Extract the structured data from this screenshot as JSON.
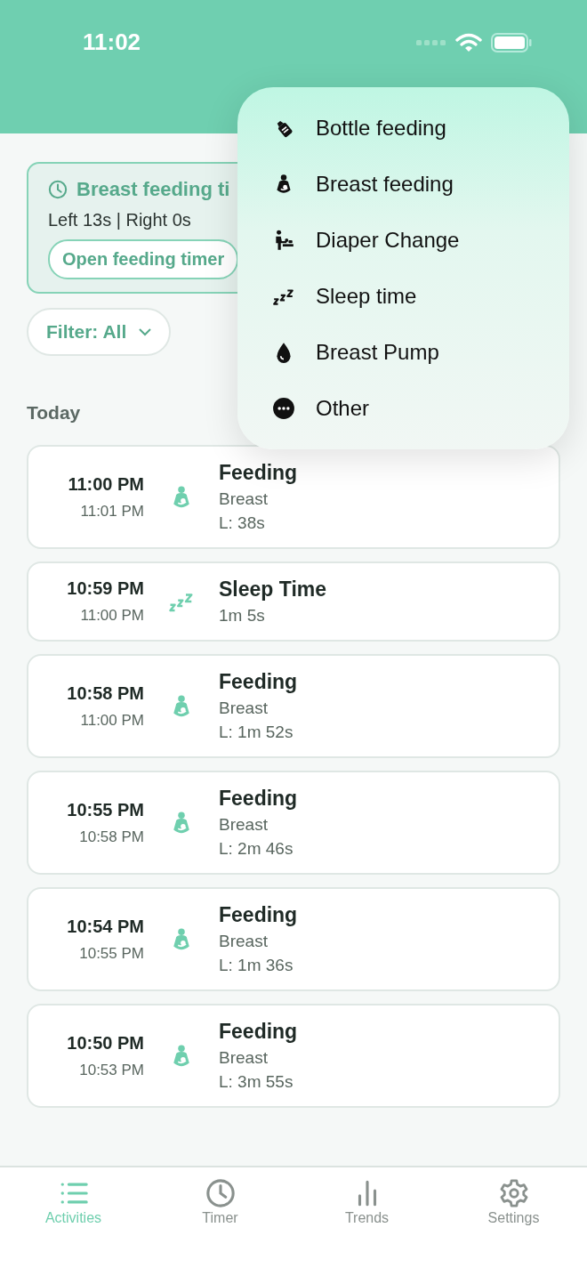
{
  "status_bar": {
    "time": "11:02"
  },
  "timer_card": {
    "title": "Breast feeding ti",
    "detail": "Left 13s | Right 0s",
    "button": "Open feeding timer"
  },
  "filter": {
    "label": "Filter: All"
  },
  "section": "Today",
  "entries": [
    {
      "kind": "feeding",
      "start": "11:00 PM",
      "end": "11:01 PM",
      "title": "Feeding",
      "lines": [
        "Breast",
        "L: 38s"
      ]
    },
    {
      "kind": "sleep",
      "start": "10:59 PM",
      "end": "11:00 PM",
      "title": "Sleep Time",
      "lines": [
        "1m 5s"
      ]
    },
    {
      "kind": "feeding",
      "start": "10:58 PM",
      "end": "11:00 PM",
      "title": "Feeding",
      "lines": [
        "Breast",
        "L: 1m 52s"
      ]
    },
    {
      "kind": "feeding",
      "start": "10:55 PM",
      "end": "10:58 PM",
      "title": "Feeding",
      "lines": [
        "Breast",
        "L: 2m 46s"
      ]
    },
    {
      "kind": "feeding",
      "start": "10:54 PM",
      "end": "10:55 PM",
      "title": "Feeding",
      "lines": [
        "Breast",
        "L: 1m 36s"
      ]
    },
    {
      "kind": "feeding",
      "start": "10:50 PM",
      "end": "10:53 PM",
      "title": "Feeding",
      "lines": [
        "Breast",
        "L: 3m 55s"
      ]
    }
  ],
  "menu": [
    {
      "kind": "bottle",
      "label": "Bottle feeding"
    },
    {
      "kind": "feeding",
      "label": "Breast feeding"
    },
    {
      "kind": "diaper",
      "label": "Diaper Change"
    },
    {
      "kind": "sleep",
      "label": "Sleep time"
    },
    {
      "kind": "pump",
      "label": "Breast Pump"
    },
    {
      "kind": "other",
      "label": "Other"
    }
  ],
  "tabs": [
    {
      "kind": "list",
      "label": "Activities",
      "selected": true
    },
    {
      "kind": "clock",
      "label": "Timer",
      "selected": false
    },
    {
      "kind": "chart",
      "label": "Trends",
      "selected": false
    },
    {
      "kind": "gear",
      "label": "Settings",
      "selected": false
    }
  ]
}
